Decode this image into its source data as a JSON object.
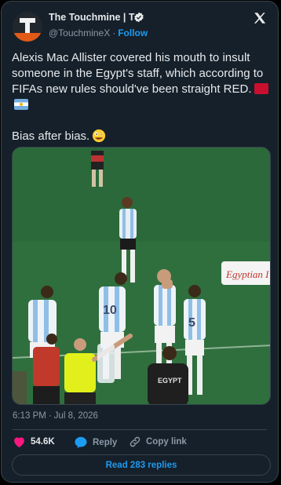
{
  "author": {
    "display_name": "The Touchmine | T",
    "handle": "@TouchmineX",
    "follow_label": "Follow",
    "verified": true
  },
  "tweet": {
    "text_main": "Alexis Mac Allister covered his mouth to insult someone in the Egypt's staff, which according to FIFAs new rules should've been straight RED.",
    "flags": [
      "egypt-flag-icon",
      "argentina-flag-icon"
    ],
    "text_second": "Bias after bias.",
    "emoji": "zany-face-emoji"
  },
  "media": {
    "banner_text": "Egyptian I",
    "jersey_text": "EGYPT"
  },
  "meta": {
    "time": "6:13 PM",
    "date": "Jul 8, 2026"
  },
  "actions": {
    "likes": "54.6K",
    "reply_label": "Reply",
    "copy_label": "Copy link"
  },
  "read_replies_label": "Read 283 replies",
  "colors": {
    "background": "#15202b",
    "accent": "#1d9bf0",
    "like": "#f91880",
    "text": "#e7e9ea",
    "muted": "#8b98a5"
  }
}
